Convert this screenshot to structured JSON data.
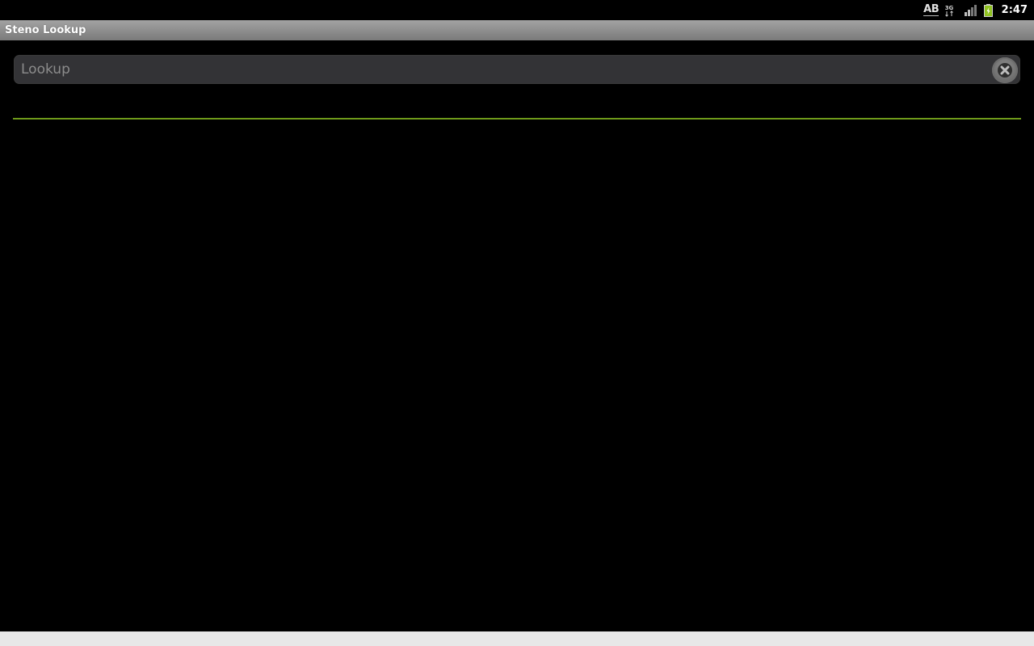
{
  "status_bar": {
    "ime_label": "AB",
    "network_type": "3G",
    "time": "2:47",
    "icons": [
      "keyboard-ime-icon",
      "network-3g-icon",
      "signal-strength-icon",
      "battery-charging-icon"
    ],
    "battery_color": "#8fc21f"
  },
  "title_bar": {
    "title": "Steno Lookup"
  },
  "search": {
    "value": "",
    "placeholder": "Lookup",
    "clear_icon": "clear-icon"
  },
  "colors": {
    "background": "#000000",
    "divider_accent": "#6f9a1a",
    "search_field_bg": "#333336",
    "title_bar_bg": "#8f8f8f"
  },
  "results": []
}
